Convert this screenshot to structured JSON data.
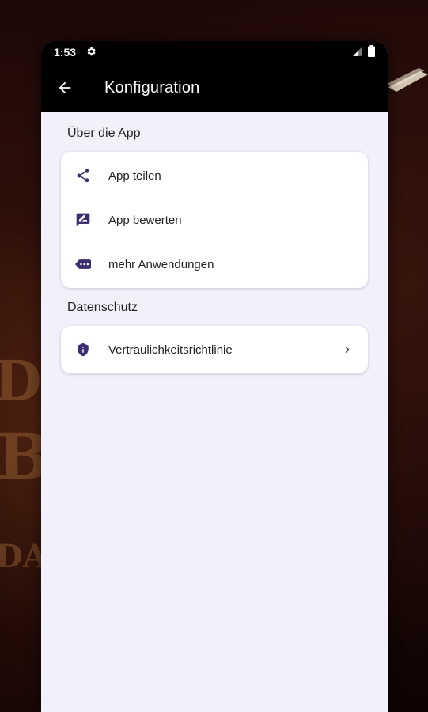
{
  "status_bar": {
    "time": "1:53",
    "settings_icon": "gear-icon",
    "signal_icon": "signal-icon",
    "battery_icon": "battery-icon"
  },
  "app_bar": {
    "back_icon": "arrow-back-icon",
    "title": "Konfiguration"
  },
  "colors": {
    "accent": "#3d2f6f",
    "background": "#f2f1fb",
    "card": "#ffffff",
    "app_bar": "#000000"
  },
  "sections": [
    {
      "header": "Über die App",
      "items": [
        {
          "label": "App teilen",
          "icon": "share-icon"
        },
        {
          "label": "App bewerten",
          "icon": "rate-review-icon"
        },
        {
          "label": "mehr Anwendungen",
          "icon": "more-apps-icon"
        }
      ]
    },
    {
      "header": "Datenschutz",
      "items": [
        {
          "label": "Vertraulichkeitsrichtlinie",
          "icon": "privacy-shield-icon",
          "chevron": "chevron-right-icon"
        }
      ]
    }
  ]
}
